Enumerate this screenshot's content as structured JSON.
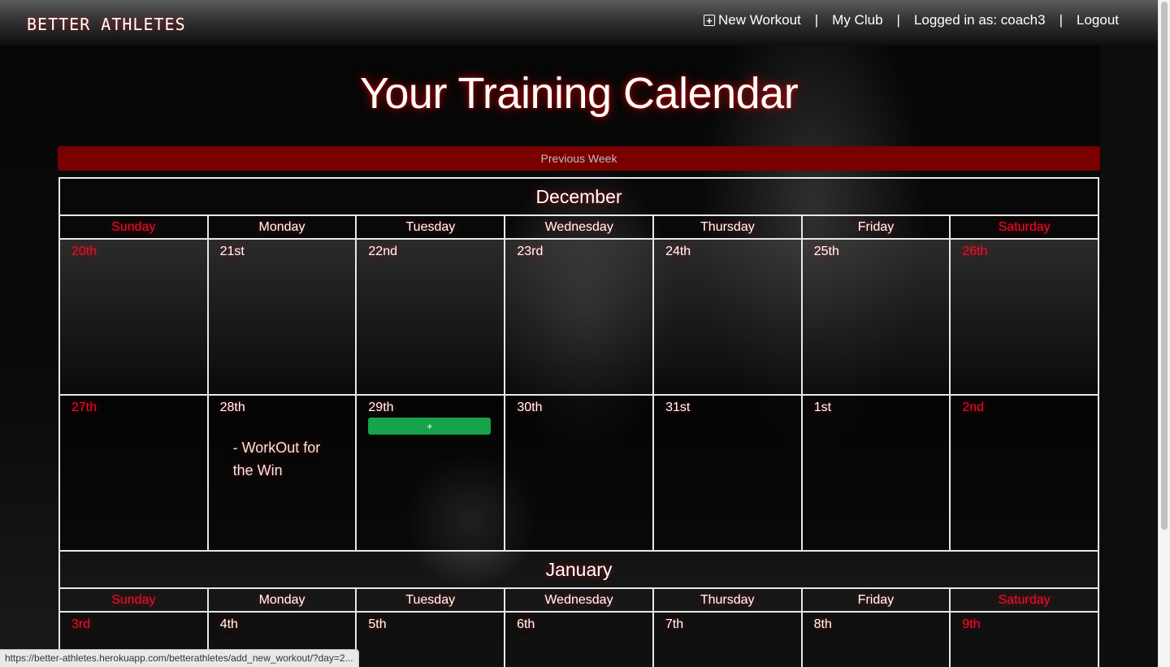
{
  "navbar": {
    "brand": "BETTER ATHLETES",
    "new_workout": "New Workout",
    "sep": "|",
    "my_club": "My Club",
    "logged_in": "Logged in as: coach3",
    "logout": "Logout"
  },
  "page_title": "Your Training Calendar",
  "prev_week": "Previous Week",
  "weekdays": [
    "Sunday",
    "Monday",
    "Tuesday",
    "Wednesday",
    "Thursday",
    "Friday",
    "Saturday"
  ],
  "december": {
    "month": "December",
    "week1": [
      "20th",
      "21st",
      "22nd",
      "23rd",
      "24th",
      "25th",
      "26th"
    ],
    "week2": [
      "27th",
      "28th",
      "29th",
      "30th",
      "31st",
      "1st",
      "2nd"
    ],
    "workout": "- WorkOut for the Win",
    "add_label": "+"
  },
  "january": {
    "month": "January",
    "week1": [
      "3rd",
      "4th",
      "5th",
      "6th",
      "7th",
      "8th",
      "9th"
    ]
  },
  "status_url": "https://better-athletes.herokuapp.com/betterathletes/add_new_workout/?day=2..."
}
